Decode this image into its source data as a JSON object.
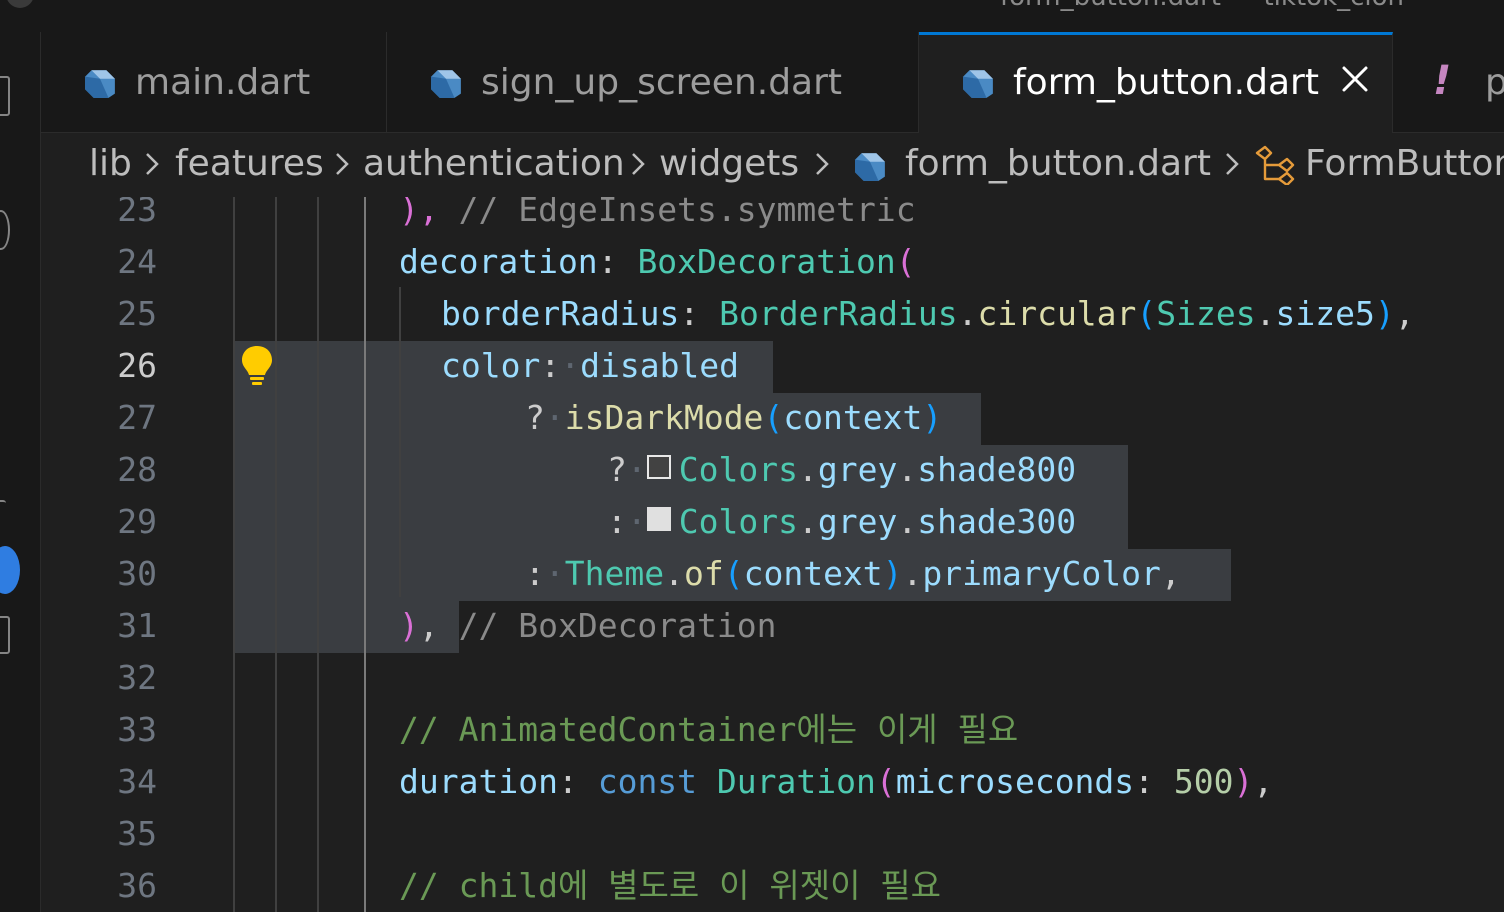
{
  "titlebar": {
    "partial_title": "form_button.dart — tiktok_clon"
  },
  "tabs": [
    {
      "label": "main.dart",
      "icon": "dart-file-icon"
    },
    {
      "label": "sign_up_screen.dart",
      "icon": "dart-file-icon"
    },
    {
      "label": "form_button.dart",
      "icon": "dart-file-icon",
      "active": true,
      "close": "close-icon"
    },
    {
      "label": "p",
      "icon": "warning-exclamation-icon"
    }
  ],
  "breadcrumb": [
    "lib",
    "features",
    "authentication",
    "widgets",
    "form_button.dart",
    "FormButton"
  ],
  "editor": {
    "active_line": 26,
    "line_numbers": [
      "23",
      "24",
      "25",
      "26",
      "27",
      "28",
      "29",
      "30",
      "31",
      "32",
      "33",
      "34",
      "35",
      "36"
    ],
    "colors": {
      "selection": "#3a3d41",
      "swatch_shade800": "#424242",
      "swatch_shade300": "#e0e0e0",
      "lightbulb": "#ffcc00"
    },
    "lines": {
      "l23": [
        [
          "p1",
          "),"
        ],
        [
          "pu",
          " "
        ],
        [
          "cmg",
          "// EdgeInsets.symmetric"
        ]
      ],
      "l24": [
        [
          "prop",
          "decoration"
        ],
        [
          "pu",
          ": "
        ],
        [
          "cls",
          "BoxDecoration"
        ],
        [
          "p1",
          "("
        ]
      ],
      "l25": [
        [
          "prop",
          "borderRadius"
        ],
        [
          "pu",
          ": "
        ],
        [
          "cls",
          "BorderRadius"
        ],
        [
          "pu",
          "."
        ],
        [
          "fn",
          "circular"
        ],
        [
          "p2",
          "("
        ],
        [
          "cls",
          "Sizes"
        ],
        [
          "pu",
          "."
        ],
        [
          "prop",
          "size5"
        ],
        [
          "p2",
          ")"
        ],
        [
          "pu",
          ","
        ]
      ],
      "l26": [
        [
          "prop",
          "color"
        ],
        [
          "pu",
          ":"
        ],
        [
          "ws",
          "·"
        ],
        [
          "prop",
          "disabled"
        ]
      ],
      "l27": [
        [
          "pu",
          "?"
        ],
        [
          "ws",
          "·"
        ],
        [
          "fn",
          "isDarkMode"
        ],
        [
          "p2",
          "("
        ],
        [
          "prop",
          "context"
        ],
        [
          "p2",
          ")"
        ]
      ],
      "l28": [
        [
          "pu",
          "?"
        ],
        [
          "ws",
          "·"
        ],
        [
          "sw800",
          ""
        ],
        [
          "cls",
          "Colors"
        ],
        [
          "pu",
          "."
        ],
        [
          "prop",
          "grey"
        ],
        [
          "pu",
          "."
        ],
        [
          "prop",
          "shade800"
        ]
      ],
      "l29": [
        [
          "pu",
          ":"
        ],
        [
          "ws",
          "·"
        ],
        [
          "sw300",
          ""
        ],
        [
          "cls",
          "Colors"
        ],
        [
          "pu",
          "."
        ],
        [
          "prop",
          "grey"
        ],
        [
          "pu",
          "."
        ],
        [
          "prop",
          "shade300"
        ]
      ],
      "l30": [
        [
          "pu",
          ":"
        ],
        [
          "ws",
          "·"
        ],
        [
          "cls",
          "Theme"
        ],
        [
          "pu",
          "."
        ],
        [
          "fn",
          "of"
        ],
        [
          "p2",
          "("
        ],
        [
          "prop",
          "context"
        ],
        [
          "p2",
          ")"
        ],
        [
          "pu",
          "."
        ],
        [
          "prop",
          "primaryColor"
        ],
        [
          "pu",
          ","
        ]
      ],
      "l31": [
        [
          "p1",
          ")"
        ],
        [
          "pu",
          ","
        ],
        [
          "pu",
          " "
        ],
        [
          "cmg",
          "// BoxDecoration"
        ]
      ],
      "l32": [],
      "l33": [
        [
          "cm",
          "// AnimatedContainer에는 이게 필요"
        ]
      ],
      "l34": [
        [
          "prop",
          "duration"
        ],
        [
          "pu",
          ": "
        ],
        [
          "kw",
          "const"
        ],
        [
          "pu",
          " "
        ],
        [
          "cls",
          "Duration"
        ],
        [
          "p1",
          "("
        ],
        [
          "prop",
          "microseconds"
        ],
        [
          "pu",
          ": "
        ],
        [
          "num",
          "500"
        ],
        [
          "p1",
          ")"
        ],
        [
          "pu",
          ","
        ]
      ],
      "l35": [],
      "l36": [
        [
          "cm",
          "// child에 별도로 이 위젯이 필요"
        ]
      ]
    }
  }
}
